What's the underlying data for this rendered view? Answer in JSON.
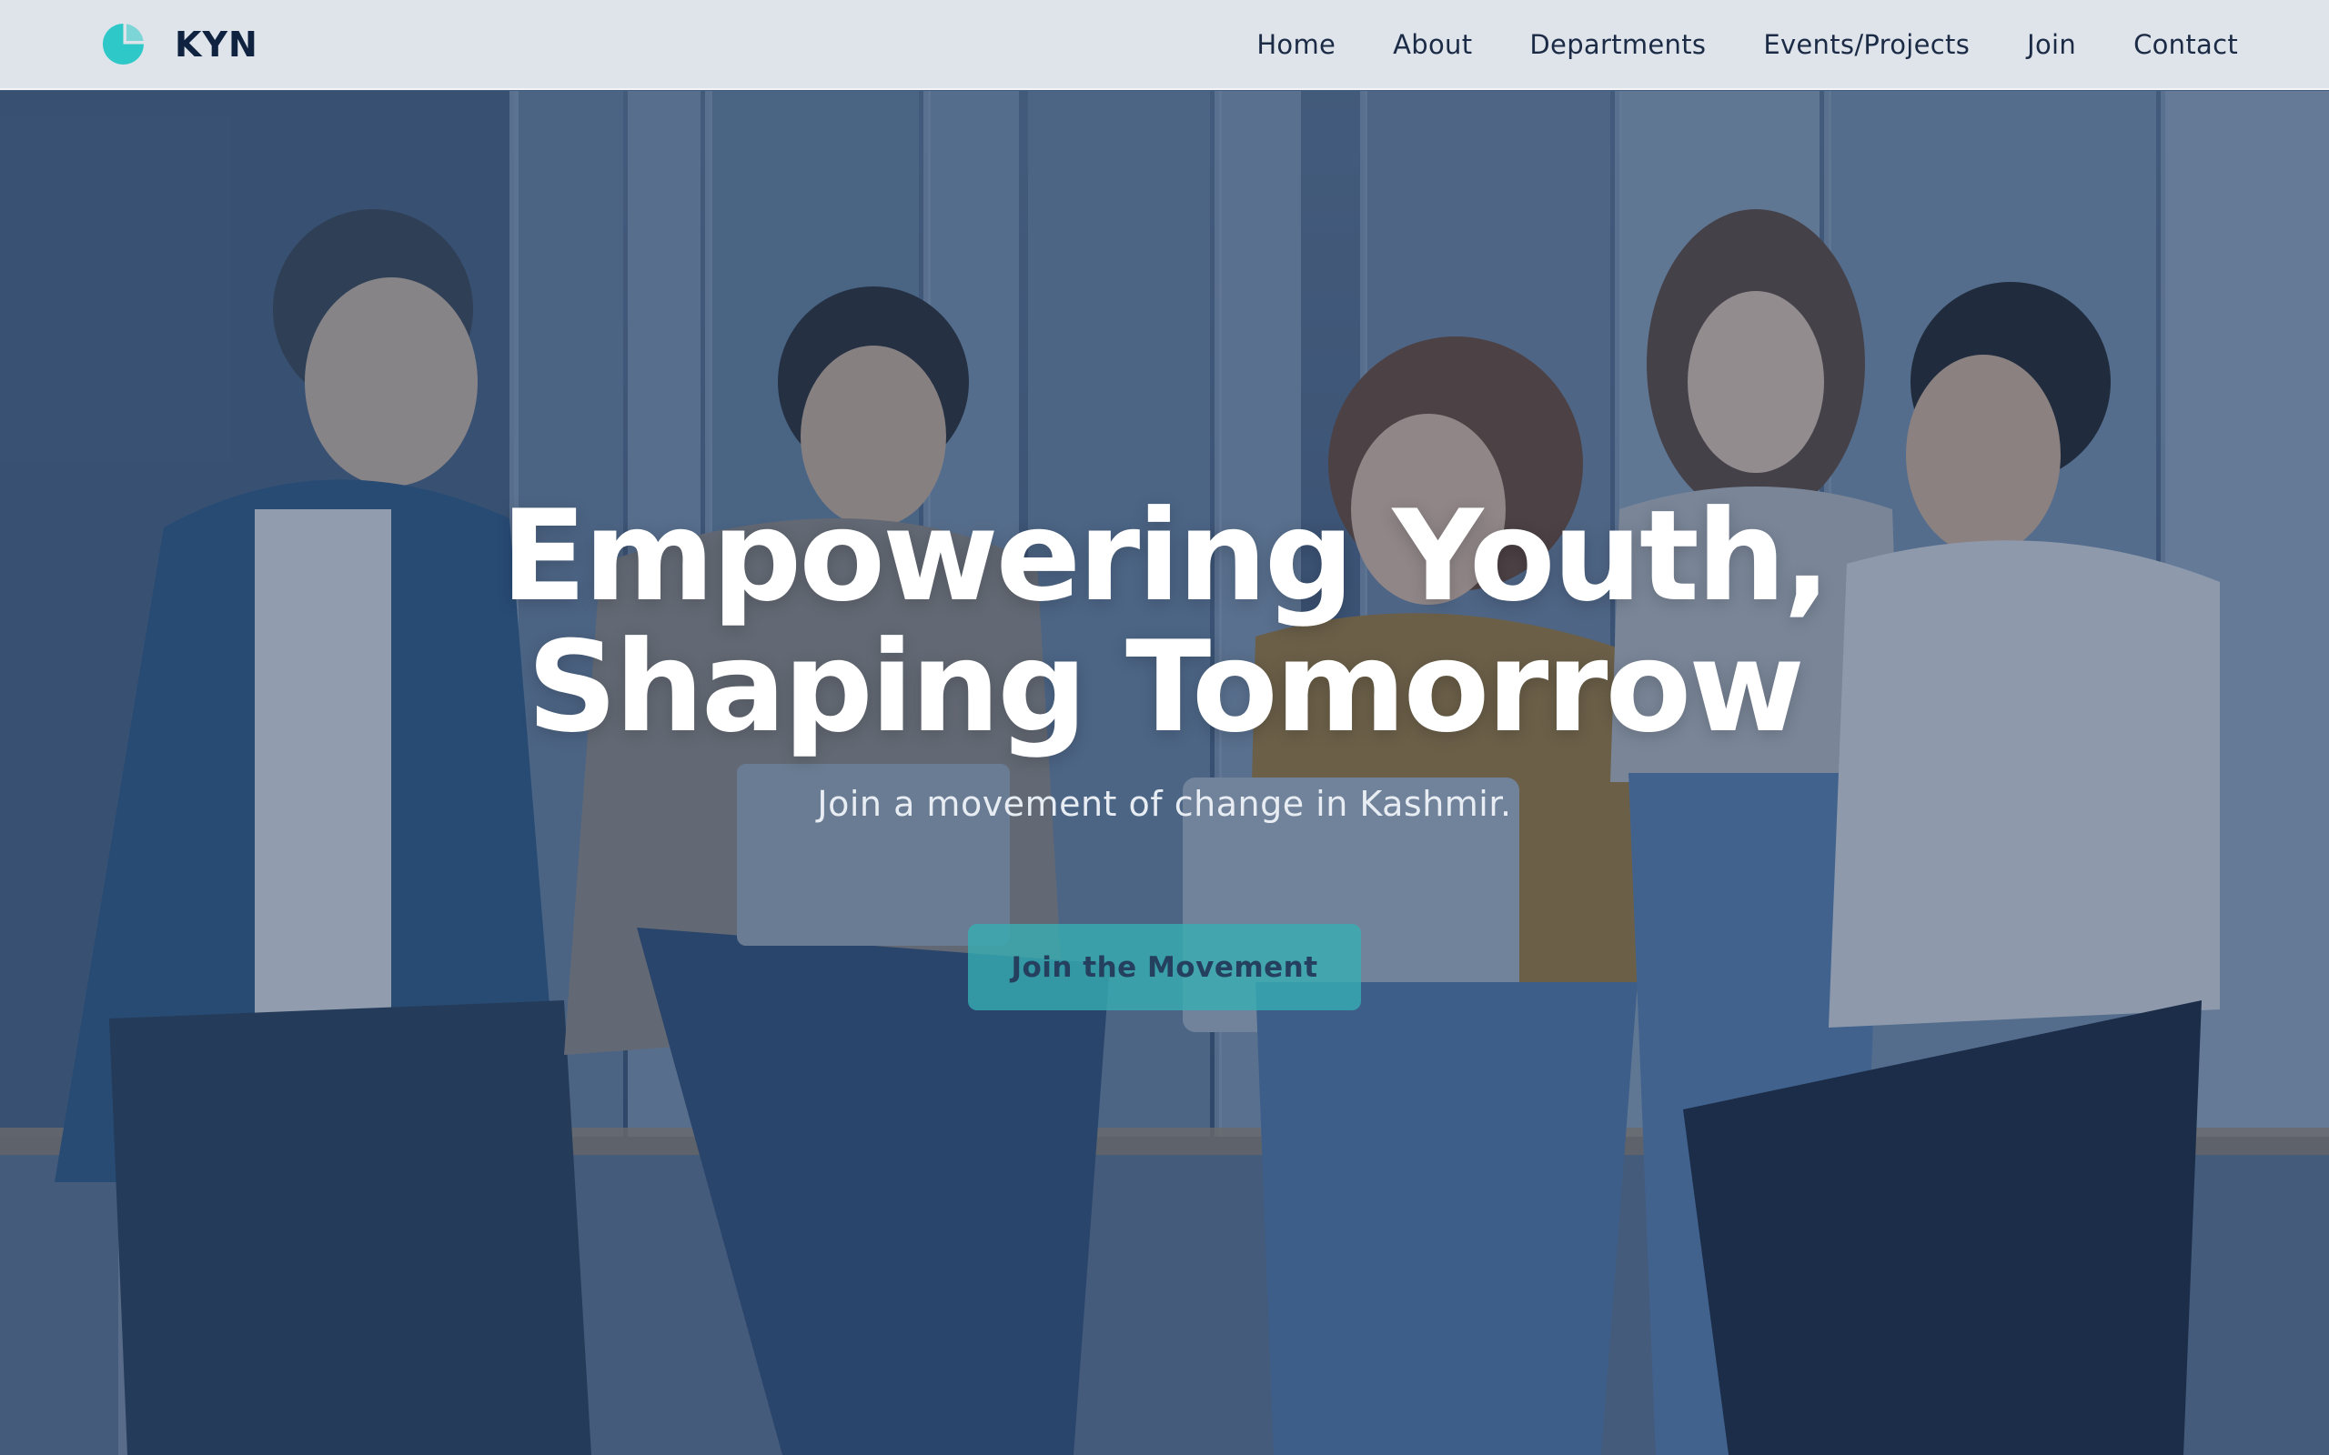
{
  "brand": {
    "name": "KYN",
    "mark_icon": "teal-circle-logo-icon",
    "accent_color": "#2ec8c8"
  },
  "nav": {
    "items": [
      {
        "label": "Home"
      },
      {
        "label": "About"
      },
      {
        "label": "Departments"
      },
      {
        "label": "Events/Projects"
      },
      {
        "label": "Join"
      },
      {
        "label": "Contact"
      }
    ]
  },
  "hero": {
    "title_line1": "Empowering Youth,",
    "title_line2": "Shaping Tomorrow",
    "subtitle": "Join a movement of change in Kashmir.",
    "cta_label": "Join the Movement",
    "cta_color": "#36b0b4",
    "background_image": "group-of-young-people-sitting-with-laptops"
  }
}
